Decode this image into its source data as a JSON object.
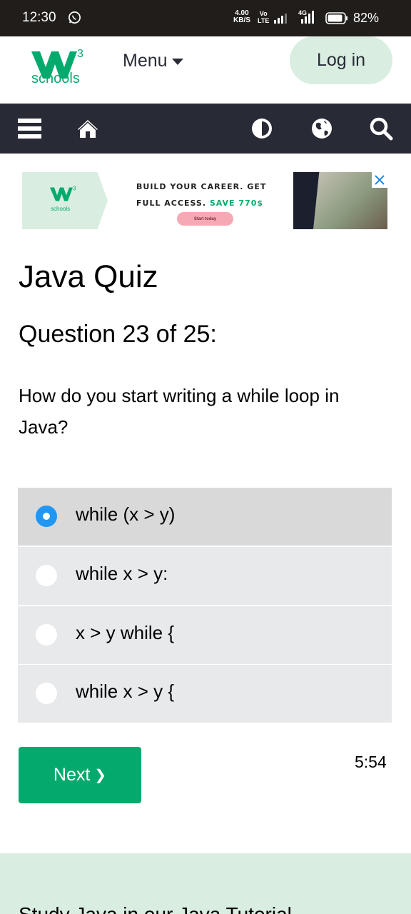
{
  "status_bar": {
    "time": "12:30",
    "net_speed_value": "4.00",
    "net_speed_unit": "KB/S",
    "volte_top": "Vo",
    "volte_bottom": "LTE",
    "network_type": "4G",
    "battery_percent": "82%"
  },
  "header": {
    "logo_text": "schools",
    "logo_superscript": "3",
    "menu_label": "Menu",
    "login_label": "Log in"
  },
  "navbar": {
    "icons": [
      "hamburger-icon",
      "home-icon",
      "contrast-icon",
      "globe-icon",
      "search-icon"
    ]
  },
  "ad": {
    "logo_text": "schools",
    "headline_line1": "BUILD YOUR CAREER. GET",
    "headline_line2": "FULL ACCESS.",
    "headline_save": "SAVE 770$",
    "cta_label": "Start today"
  },
  "quiz": {
    "title": "Java Quiz",
    "question_heading": "Question 23 of 25:",
    "question_text": "How do you start writing a while loop in Java?",
    "options": [
      {
        "label": "while (x > y)",
        "selected": true
      },
      {
        "label": "while x > y:",
        "selected": false
      },
      {
        "label": "x > y while {",
        "selected": false
      },
      {
        "label": "while x > y {",
        "selected": false
      }
    ],
    "next_label": "Next",
    "next_chevron": "❯",
    "timer": "5:54"
  },
  "footer": {
    "text": "Study Java in our Java Tutorial"
  },
  "colors": {
    "brand_green": "#04AA6D",
    "nav_dark": "#282A35",
    "light_green": "#d9eee1",
    "radio_blue": "#2196F3",
    "option_bg": "#e7e9eb",
    "option_selected_bg": "#d9d9d9"
  }
}
